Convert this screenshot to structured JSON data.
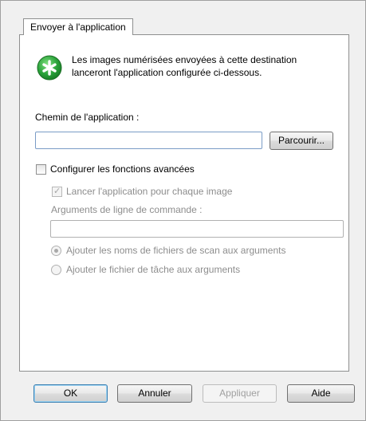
{
  "tab": {
    "label": "Envoyer à l'application"
  },
  "info": {
    "icon": "green-star-icon",
    "text_line1": "Les images numérisées envoyées à cette destination",
    "text_line2": "lanceront l'application configurée ci-dessous."
  },
  "app_path": {
    "label": "Chemin de l'application :",
    "value": "",
    "browse_label": "Parcourir..."
  },
  "advanced": {
    "checkbox_label": "Configurer les fonctions avancées",
    "launch_per_image_label": "Lancer l'application pour chaque image",
    "cmd_args_label": "Arguments de ligne de commande :",
    "cmd_args_value": "",
    "radio_add_filenames_label": "Ajouter les noms de fichiers de scan aux arguments",
    "radio_add_taskfile_label": "Ajouter le fichier de tâche aux arguments"
  },
  "buttons": {
    "ok": "OK",
    "cancel": "Annuler",
    "apply": "Appliquer",
    "help": "Aide"
  },
  "colors": {
    "icon_green": "#2aa23a",
    "field_border": "#7a9cc6"
  }
}
